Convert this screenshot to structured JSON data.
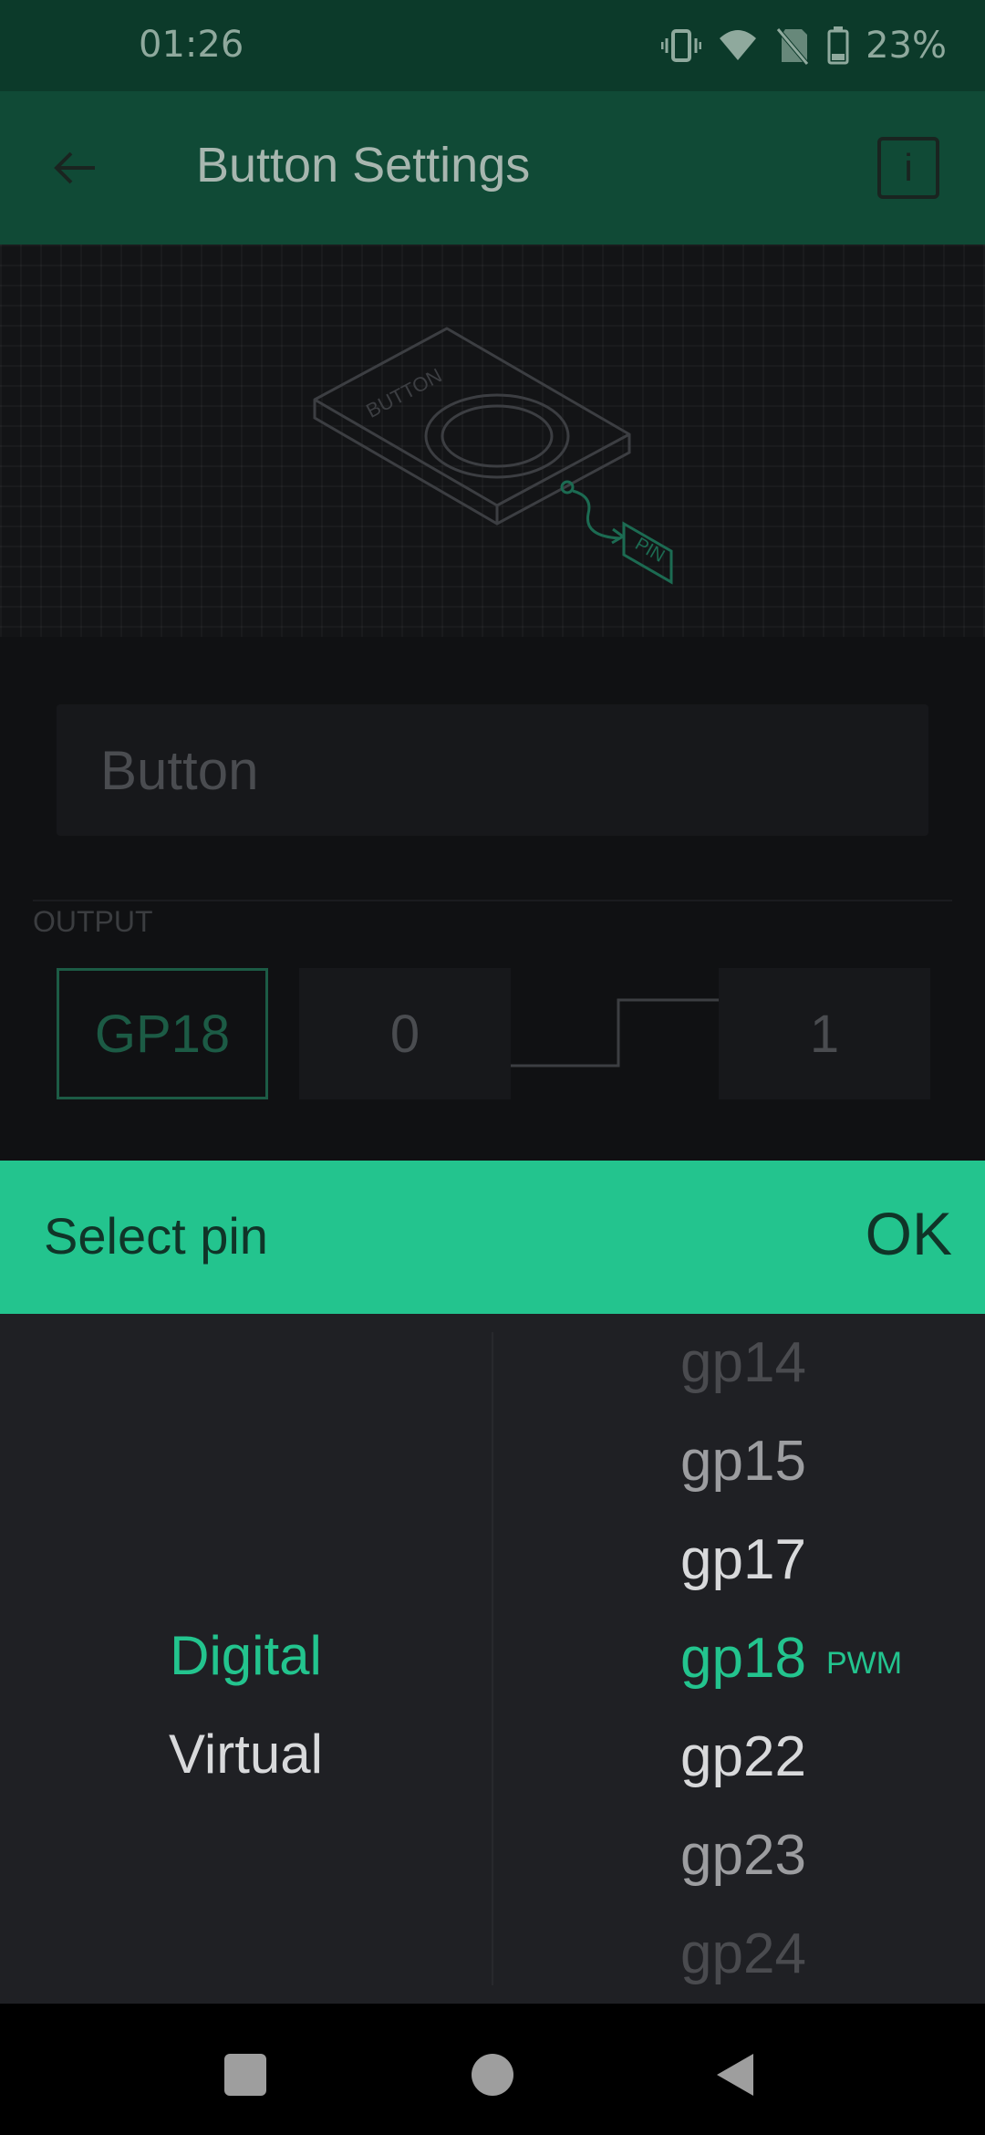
{
  "status": {
    "time": "01:26",
    "battery": "23%"
  },
  "app_bar": {
    "title": "Button Settings",
    "info": "i"
  },
  "illustration": {
    "device_label": "BUTTON",
    "pin_label": "PIN"
  },
  "form": {
    "name_value": "Button",
    "output_label": "OUTPUT",
    "pin": "GP18",
    "low_value": "0",
    "high_value": "1"
  },
  "picker": {
    "title": "Select pin",
    "ok": "OK",
    "types": [
      "Digital",
      "Virtual"
    ],
    "selected_type": "Digital",
    "pins": [
      "gp14",
      "gp15",
      "gp17",
      "gp18",
      "gp22",
      "gp23",
      "gp24"
    ],
    "selected_pin": "gp18",
    "selected_tag": "PWM"
  },
  "colors": {
    "accent": "#23c48e",
    "app_bar": "#104a36",
    "status_bar": "#0c3a2a",
    "picker_bg": "#1f2024"
  }
}
